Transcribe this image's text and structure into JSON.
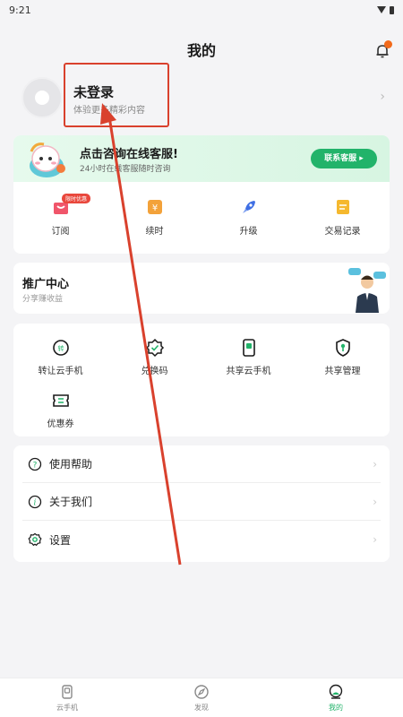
{
  "status_bar": {
    "time": "9:21"
  },
  "header": {
    "title": "我的"
  },
  "profile": {
    "name": "未登录",
    "subtitle": "体验更多精彩内容"
  },
  "service": {
    "title": "点击咨询在线客服!",
    "subtitle": "24小时在线客服随时咨询",
    "contact_label": "联系客服 ▸",
    "items": [
      {
        "label": "订阅",
        "badge": "限时优惠",
        "icon": "bag-icon"
      },
      {
        "label": "续时",
        "icon": "renew-icon"
      },
      {
        "label": "升级",
        "icon": "rocket-icon"
      },
      {
        "label": "交易记录",
        "icon": "record-icon"
      }
    ]
  },
  "promo": {
    "title": "推广中心",
    "subtitle": "分享赚收益"
  },
  "tools": {
    "items": [
      {
        "label": "转让云手机",
        "icon": "transfer-icon"
      },
      {
        "label": "兑换码",
        "icon": "redeem-icon"
      },
      {
        "label": "共享云手机",
        "icon": "share-phone-icon"
      },
      {
        "label": "共享管理",
        "icon": "share-manage-icon"
      },
      {
        "label": "优惠券",
        "icon": "coupon-icon"
      }
    ]
  },
  "menu": {
    "items": [
      {
        "label": "使用帮助",
        "icon": "help-icon"
      },
      {
        "label": "关于我们",
        "icon": "info-icon"
      },
      {
        "label": "设置",
        "icon": "settings-icon"
      }
    ]
  },
  "bottom_nav": {
    "items": [
      {
        "label": "云手机",
        "icon": "cloud-phone-icon"
      },
      {
        "label": "发现",
        "icon": "compass-icon"
      },
      {
        "label": "我的",
        "icon": "profile-icon",
        "active": true
      }
    ]
  },
  "colors": {
    "accent": "#22b36a",
    "highlight": "#d9412d",
    "badge": "#e9473c",
    "bell_dot": "#f26a1b"
  }
}
